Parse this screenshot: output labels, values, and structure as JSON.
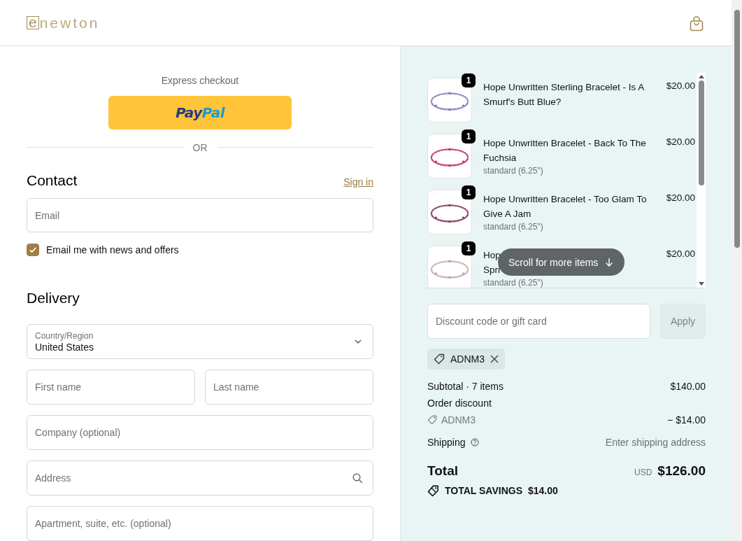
{
  "header": {
    "logo": {
      "mark": "e",
      "text": "newton"
    }
  },
  "express_checkout": {
    "title": "Express checkout",
    "paypal": {
      "pay": "Pay",
      "pal": "Pal"
    },
    "divider": "OR"
  },
  "contact": {
    "heading": "Contact",
    "sign_in": "Sign in",
    "email": {
      "placeholder": "Email"
    },
    "news_checkbox": {
      "label": "Email me with news and offers",
      "checked": true
    }
  },
  "delivery": {
    "heading": "Delivery",
    "country": {
      "label": "Country/Region",
      "value": "United States"
    },
    "rows": [
      {
        "fields": [
          {
            "placeholder": "First name",
            "kind": "text"
          },
          {
            "placeholder": "Last name",
            "kind": "text"
          }
        ]
      },
      {
        "fields": [
          {
            "placeholder": "Company (optional)",
            "kind": "text"
          }
        ]
      },
      {
        "fields": [
          {
            "placeholder": "Address",
            "kind": "search"
          }
        ]
      },
      {
        "fields": [
          {
            "placeholder": "Apartment, suite, etc. (optional)",
            "kind": "text"
          }
        ]
      }
    ]
  },
  "order": {
    "items": [
      {
        "quantity": "1",
        "title": "Hope Unwritten Sterling Bracelet - Is A Smurf's Butt Blue?",
        "price": "$20.00"
      },
      {
        "quantity": "1",
        "title": "Hope Unwritten Bracelet - Back To The Fuchsia",
        "variant": "standard (6.25\")",
        "price": "$20.00"
      },
      {
        "quantity": "1",
        "title": "Hope Unwritten Bracelet - Too Glam To Give A Jam",
        "variant": "standard (6.25\")",
        "price": "$20.00"
      },
      {
        "quantity": "1",
        "title": "Hop\nSpri",
        "variant": "standard (6.25\")",
        "price": "$20.00"
      }
    ],
    "scroll_hint": "Scroll for more items",
    "discount": {
      "placeholder": "Discount code or gift card",
      "apply": "Apply",
      "apply_disabled": true
    },
    "applied_codes": [
      {
        "code": "ADNM3"
      }
    ],
    "subtotal": {
      "label": "Subtotal · 7 items",
      "value": "$140.00"
    },
    "order_discount": {
      "label": "Order discount",
      "code": "ADNM3",
      "value": "− $14.00"
    },
    "shipping": {
      "label": "Shipping",
      "value": "Enter shipping address"
    },
    "total": {
      "label": "Total",
      "currency": "USD",
      "value": "$126.00"
    },
    "savings": {
      "label": "TOTAL SAVINGS",
      "value": "$14.00"
    }
  }
}
